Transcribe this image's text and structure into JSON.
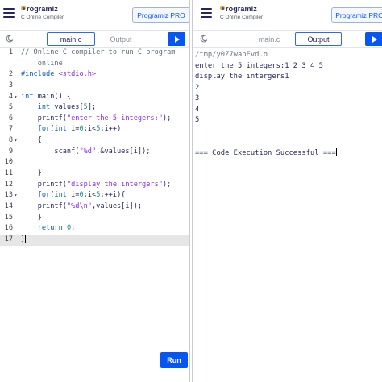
{
  "brand": {
    "name": "rogramiz",
    "sub": "C Online Compiler",
    "pro": "Programiz PRO"
  },
  "editor": {
    "file_tab": "main.c",
    "output_tab": "Output",
    "run_label": "Run",
    "lines": [
      {
        "n": "1",
        "fold": "",
        "html": "<span class=\"cmt\">// Online C compiler to run C program</span>"
      },
      {
        "n": "",
        "fold": "",
        "html": "<span class=\"cmt\">    online</span>"
      },
      {
        "n": "2",
        "fold": "",
        "html": "<span class=\"kw\">#include</span> <span class=\"inc\">&lt;stdio.h&gt;</span>"
      },
      {
        "n": "3",
        "fold": "",
        "html": ""
      },
      {
        "n": "4",
        "fold": "▾",
        "html": "<span class=\"kw\">int</span> main() {"
      },
      {
        "n": "5",
        "fold": "",
        "html": "    <span class=\"kw\">int</span> values[<span class=\"num\">5</span>];"
      },
      {
        "n": "6",
        "fold": "",
        "html": "    printf(<span class=\"str\">\"enter the 5 integers:\"</span>);"
      },
      {
        "n": "7",
        "fold": "",
        "html": "    <span class=\"kw\">for</span>(<span class=\"kw\">int</span> i=<span class=\"num\">0</span>;i&lt;<span class=\"num\">5</span>;i++)"
      },
      {
        "n": "8",
        "fold": "▾",
        "html": "    {"
      },
      {
        "n": "9",
        "fold": "",
        "html": "        scanf(<span class=\"str\">\"%d\"</span>,&amp;values[i]);"
      },
      {
        "n": "10",
        "fold": "",
        "html": ""
      },
      {
        "n": "11",
        "fold": "",
        "html": "    }"
      },
      {
        "n": "12",
        "fold": "",
        "html": "    printf(<span class=\"str\">\"display the intergers\"</span>);"
      },
      {
        "n": "13",
        "fold": "▾",
        "html": "    <span class=\"kw\">for</span>(<span class=\"kw\">int</span> i=<span class=\"num\">0</span>;i&lt;<span class=\"num\">5</span>;++i){"
      },
      {
        "n": "14",
        "fold": "",
        "html": "    printf(<span class=\"str\">\"%d\\n\"</span>,values[i]);"
      },
      {
        "n": "15",
        "fold": "",
        "html": "    }"
      },
      {
        "n": "16",
        "fold": "",
        "html": "    <span class=\"kw\">return</span> <span class=\"num\">0</span>;"
      },
      {
        "n": "17",
        "fold": "",
        "html": "}",
        "current": true
      }
    ]
  },
  "output": {
    "file_tab": "main.c",
    "output_tab": "Output",
    "lines": [
      "/tmp/y0Z7wanEvd.o",
      "enter the 5 integers:1 2 3 4 5",
      "display the intergers1",
      "2",
      "3",
      "4",
      "5",
      "",
      "",
      "=== Code Execution Successful ==="
    ]
  }
}
